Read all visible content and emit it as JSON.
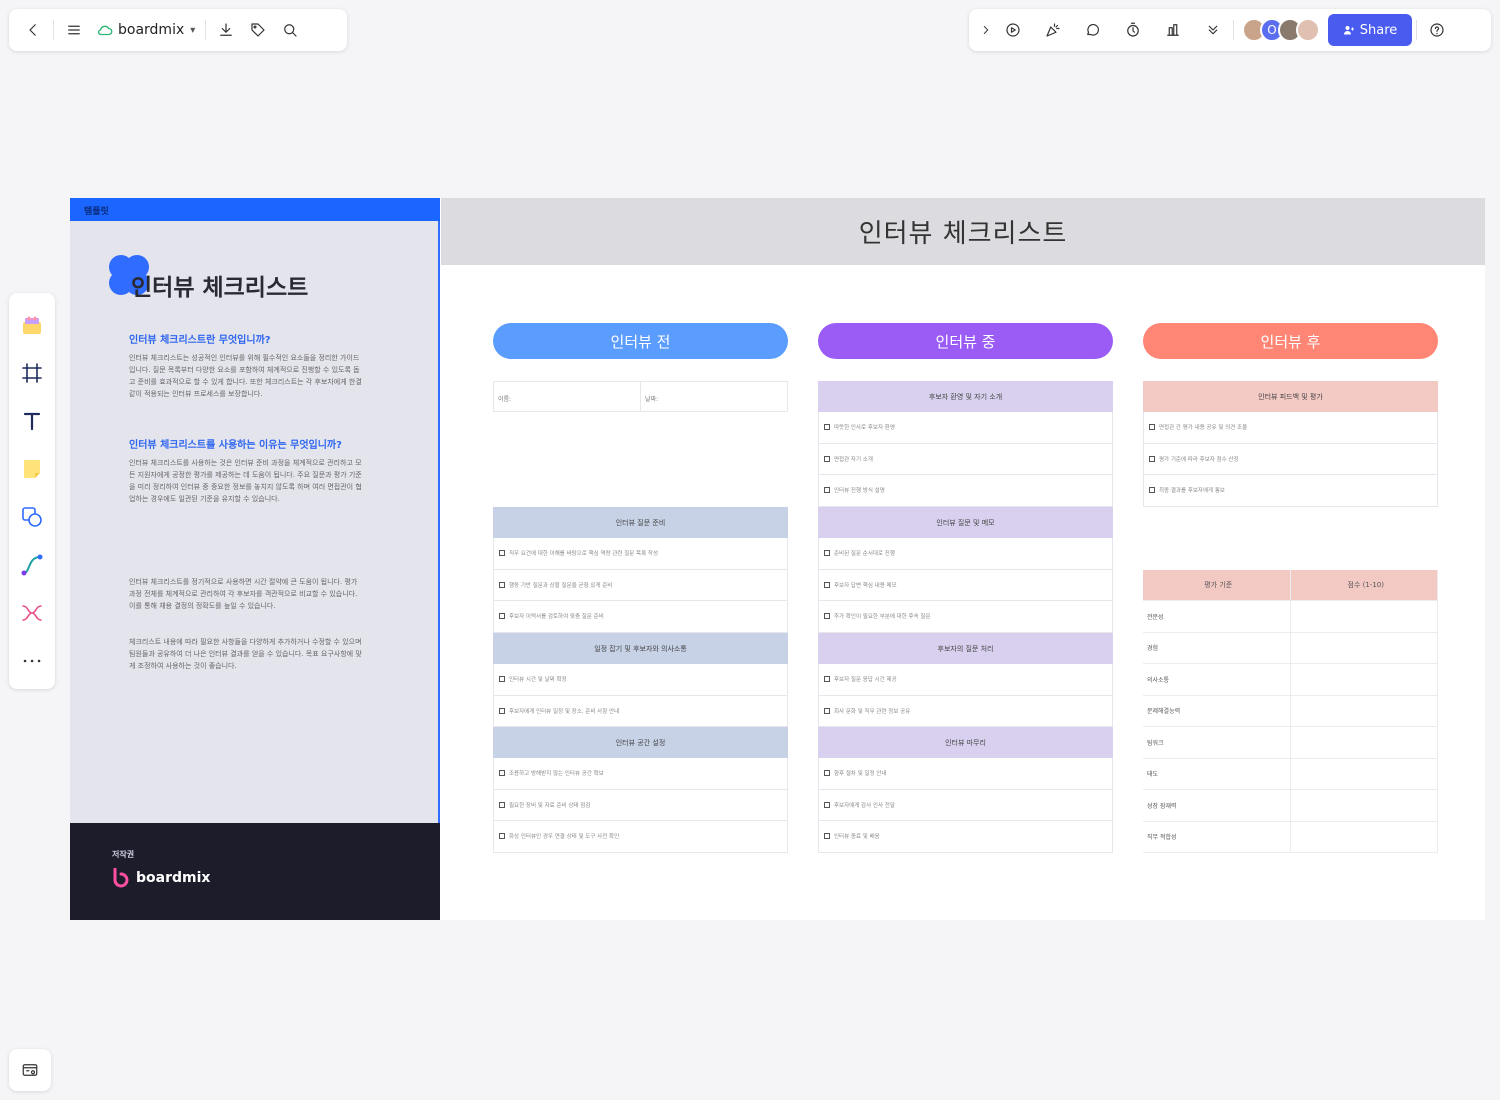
{
  "toolbar": {
    "app_name": "boardmix",
    "share_label": "Share",
    "avatar_initial": "O"
  },
  "colors": {
    "accent": "#4a5bf0",
    "blue_header": "#1a66ff",
    "pill_before": "#5b9cff",
    "pill_during": "#9b5cf5",
    "pill_after": "#ff8575",
    "section_blue": "#c7d2e7",
    "section_purple": "#d8d0ee",
    "section_pink": "#f3c9c4"
  },
  "left_panel": {
    "top_label": "템플릿",
    "title": "인터뷰 체크리스트",
    "heading1": "인터뷰 체크리스트란 무엇입니까?",
    "paragraph1": "인터뷰 체크리스트는 성공적인 인터뷰를 위해 필수적인 요소들을 정리한 가이드입니다. 질문 목록부터 다양한 요소를 포함하여 체계적으로 진행할 수 있도록 돕고 준비를 효과적으로 할 수 있게 합니다. 또한 체크리스트는 각 후보자에게 한결같이 적용되는 인터뷰 프로세스를 보장합니다.",
    "heading2": "인터뷰 체크리스트를 사용하는 이유는 무엇입니까?",
    "paragraph2": "인터뷰 체크리스트를 사용하는 것은 인터뷰 준비 과정을 체계적으로 관리하고 모든 지원자에게 공정한 평가를 제공하는 데 도움이 됩니다. 주요 질문과 평가 기준을 미리 정리하여 인터뷰 중 중요한 정보를 놓치지 않도록 하며 여러 면접관이 협업하는 경우에도 일관된 기준을 유지할 수 있습니다.",
    "paragraph3": "인터뷰 체크리스트를 정기적으로 사용하면 시간 절약에 큰 도움이 됩니다. 평가 과정 전체를 체계적으로 관리하여 각 후보자를 객관적으로 비교할 수 있습니다. 이를 통해 채용 결정의 정확도를 높일 수 있습니다.",
    "paragraph4": "체크리스트 내용에 따라 필요한 사항들을 다양하게 추가하거나 수정할 수 있으며 팀원들과 공유하여 더 나은 인터뷰 결과를 얻을 수 있습니다. 목표 요구사항에 맞게 조정하여 사용하는 것이 좋습니다.",
    "footer_label": "저작권",
    "footer_logo": "boardmix"
  },
  "right_panel": {
    "title": "인터뷰 체크리스트",
    "pill_before": "인터뷰 전",
    "pill_during": "인터뷰 중",
    "pill_after": "인터뷰 후",
    "before": {
      "field_name": "이름:",
      "field_date": "날짜:",
      "sec1_title": "인터뷰 질문 준비",
      "sec1_items": [
        "직무 요건에 대한 이해를 바탕으로 핵심 역량 관련 질문 목록 작성",
        "행동 기반 질문과 상황 질문을 균형 있게 준비",
        "후보자 이력서를 검토하여 맞춤 질문 준비"
      ],
      "sec2_title": "일정 잡기 및 후보자와 의사소통",
      "sec2_items": [
        "인터뷰 시간 및 날짜 확정",
        "후보자에게 인터뷰 일정 및 장소, 준비 사항 안내"
      ],
      "sec3_title": "인터뷰 공간 설정",
      "sec3_items": [
        "조용하고 방해받지 않는 인터뷰 공간 확보",
        "필요한 장비 및 자료 준비 상태 점검",
        "화상 인터뷰인 경우 연결 상태 및 도구 사전 확인"
      ]
    },
    "during": {
      "sec1_title": "후보자 환영 및 자기 소개",
      "sec1_items": [
        "따뜻한 인사로 후보자 환영",
        "면접관 자기 소개",
        "인터뷰 진행 방식 설명"
      ],
      "sec2_title": "인터뷰 질문 및 메모",
      "sec2_items": [
        "준비된 질문 순서대로 진행",
        "후보자 답변 핵심 내용 메모",
        "추가 확인이 필요한 부분에 대한 후속 질문"
      ],
      "sec3_title": "후보자의 질문 처리",
      "sec3_items": [
        "후보자 질문 응답 시간 제공",
        "회사 문화 및 직무 관련 정보 공유"
      ],
      "sec4_title": "인터뷰 마무리",
      "sec4_items": [
        "향후 절차 및 일정 안내",
        "후보자에게 감사 인사 전달",
        "인터뷰 종료 및 배웅"
      ]
    },
    "after": {
      "sec1_title": "인터뷰 피드백 및 평가",
      "sec1_items": [
        "면접관 간 평가 내용 공유 및 의견 조율",
        "평가 기준에 따라 후보자 점수 산정",
        "최종 결과를 후보자에게 통보"
      ],
      "eval_header_criteria": "평가 기준",
      "eval_header_score": "점수 (1-10)",
      "eval_rows": [
        "전문성",
        "경험",
        "의사소통",
        "문제해결능력",
        "팀워크",
        "태도",
        "성장 잠재력",
        "직무 적합성"
      ]
    }
  }
}
